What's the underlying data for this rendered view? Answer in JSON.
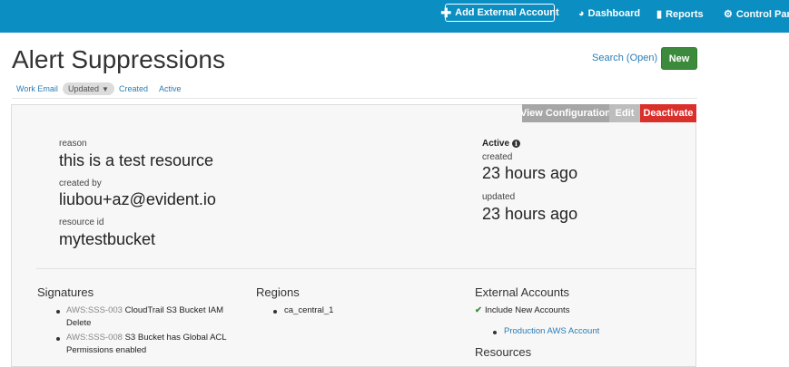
{
  "topbar": {
    "add_account_label": "Add External Account",
    "nav": [
      {
        "label": "Dashboard",
        "icon": "tachometer-icon"
      },
      {
        "label": "Reports",
        "icon": "bar-chart-icon"
      },
      {
        "label": "Control Panel",
        "icon": "cogs-icon"
      }
    ],
    "color": "#0b8ec2"
  },
  "page": {
    "title": "Alert Suppressions",
    "search_link": "Search (Open)",
    "new_button": "New"
  },
  "subnav": {
    "work_email": "Work Email",
    "updated": "Updated",
    "created": "Created",
    "active": "Active"
  },
  "toolbar": {
    "view_configuration": "View Configuration",
    "edit": "Edit",
    "deactivate": "Deactivate"
  },
  "details": {
    "reason_label": "reason",
    "reason_value": "this is a test resource",
    "created_by_label": "created by",
    "created_by_value": "liubou+az@evident.io",
    "resource_id_label": "resource id",
    "resource_id_value": "mytestbucket",
    "status": "Active",
    "created_label": "created",
    "created_value": "23 hours ago",
    "updated_label": "updated",
    "updated_value": "23 hours ago"
  },
  "signatures": {
    "heading": "Signatures",
    "items": [
      {
        "id": "AWS:SSS-003",
        "text": "CloudTrail S3 Bucket IAM",
        "text2": "Delete"
      },
      {
        "id": "AWS:SSS-008",
        "text": "S3 Bucket has Global ACL",
        "text2": "Permissions enabled"
      }
    ]
  },
  "regions": {
    "heading": "Regions",
    "items": [
      "ca_central_1"
    ]
  },
  "external_accounts": {
    "heading": "External Accounts",
    "include_new": "Include New Accounts",
    "items": [
      "Production AWS Account"
    ]
  },
  "resources": {
    "heading": "Resources"
  }
}
